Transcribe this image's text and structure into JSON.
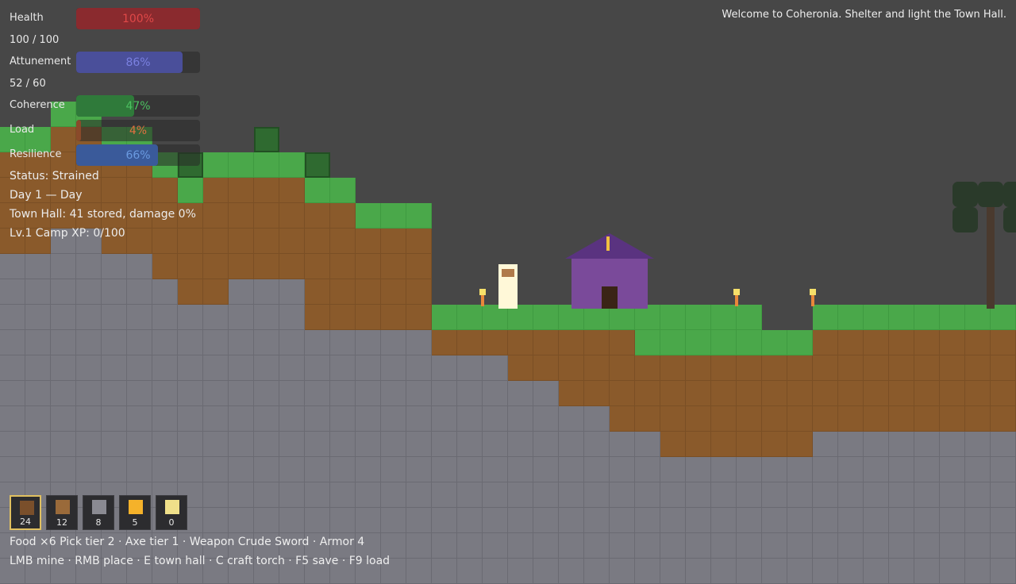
{
  "message": "Welcome to Coheronia. Shelter and light the Town Hall.",
  "stats": [
    {
      "id": "health",
      "label": "Health",
      "percent_text": "100%",
      "value": 1.0,
      "fill": "#8a2a2e",
      "text_color": "#e04848"
    },
    {
      "id": "attunement",
      "label": "Attunement",
      "percent_text": "86%",
      "value": 0.86,
      "fill": "#4a4f9a",
      "text_color": "#7a80e0"
    },
    {
      "id": "coherence",
      "label": "Coherence",
      "percent_text": "47%",
      "value": 0.47,
      "fill": "#2f7a3a",
      "text_color": "#4cc060"
    },
    {
      "id": "load",
      "label": "Load",
      "percent_text": "4%",
      "value": 0.04,
      "fill": "#8a4a2a",
      "text_color": "#e07040"
    },
    {
      "id": "resilience",
      "label": "Resilience",
      "percent_text": "66%",
      "value": 0.66,
      "fill": "#3a5a9a",
      "text_color": "#6a9ae0"
    }
  ],
  "health_numbers": "100 / 100",
  "attunement_numbers": "52 / 60",
  "status": "Status: Strained",
  "day": "Day 1 — Day",
  "town_hall": "Town Hall: 41 stored, damage 0%",
  "level": "Lv.1 Camp  XP: 0/100",
  "hotbar": [
    {
      "count": "24",
      "color": "#7a4f2b",
      "selected": true
    },
    {
      "count": "12",
      "color": "#9a6a3a",
      "selected": false
    },
    {
      "count": "8",
      "color": "#8a8a92",
      "selected": false
    },
    {
      "count": "5",
      "color": "#f5b22a",
      "selected": false
    },
    {
      "count": "0",
      "color": "#f0e08a",
      "selected": false
    }
  ],
  "equipment": "Food ×6  Pick tier 2 · Axe tier 1 · Weapon Crude Sword · Armor 4",
  "controls": "LMB mine · RMB place · E town hall · C craft torch · F5 save · F9 load",
  "colors": {
    "sky": "#474747",
    "grass": "#4aa84a",
    "dirt": "#8a5a2b",
    "stone": "#7a7a82",
    "house": "#7a4a9a",
    "roof": "#5a3380",
    "player": "#fff8d8"
  }
}
